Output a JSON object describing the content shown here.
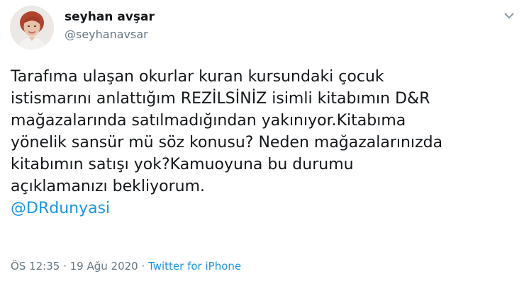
{
  "author": {
    "display_name": "seyhan avşar",
    "handle": "@seyhanavsar",
    "avatar": "profile-photo"
  },
  "tweet": {
    "lines": [
      "Tarafıma ulaşan okurlar kuran kursundaki çocuk",
      "istismarını anlattığım REZİLSİNİZ isimli kitabımın D&R",
      "mağazalarında satılmadığından yakınıyor.Kitabıma",
      "yönelik sansür mü söz konusu? Neden mağazalarınızda",
      "kitabımın satışı yok?Kamuoyuna bu durumu",
      "açıklamanızı bekliyorum."
    ],
    "mention": "@DRdunyasi"
  },
  "meta": {
    "time": "ÖS 12:35",
    "separator": " · ",
    "date": "19 Ağu 2020",
    "source": "Twitter for iPhone"
  },
  "icons": {
    "menu": "chevron-down-icon"
  },
  "colors": {
    "text": "#14171a",
    "secondary": "#657786",
    "link": "#1b95e0",
    "background": "#ffffff"
  }
}
